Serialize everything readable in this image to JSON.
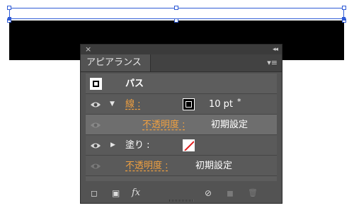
{
  "panel": {
    "close_glyph": "×",
    "collapse_glyph": "◂◂",
    "tab_label": "アピアランス",
    "menu_glyph": "▾≡"
  },
  "rows": {
    "path_label": "パス",
    "stroke_label": "線 :",
    "stroke_value": "10 pt",
    "stroke_value_marker": "*",
    "stroke_opacity_label": "不透明度 :",
    "stroke_opacity_value": "初期設定",
    "fill_label": "塗り :",
    "opacity_label": "不透明度 :",
    "opacity_value": "初期設定"
  },
  "bottom": {
    "new_stroke_glyph": "◻",
    "new_fill_glyph": "▣",
    "fx_label": "fx",
    "clear_glyph": "⊘",
    "duplicate_glyph": "◼",
    "delete_glyph": "🗑"
  },
  "icons": {
    "eye": "eye-icon",
    "disclosure_open": "triangle-down-icon",
    "disclosure_closed": "triangle-right-icon"
  },
  "colors": {
    "selection_blue": "#2f5bd6",
    "panel_bg": "#535353",
    "highlight_orange": "#f0a040"
  }
}
